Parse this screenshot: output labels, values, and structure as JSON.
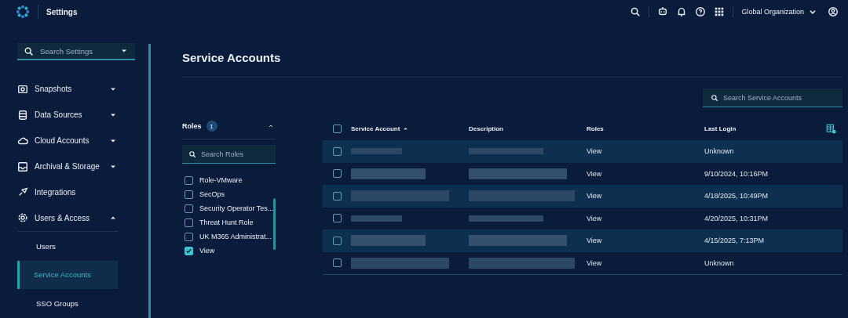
{
  "app": {
    "title": "Settings"
  },
  "header": {
    "organization": "Global Organization"
  },
  "sidebar": {
    "search": {
      "placeholder": "Search Settings"
    },
    "items": [
      {
        "label": "Snapshots",
        "kind": "camera",
        "expanded": false
      },
      {
        "label": "Data Sources",
        "kind": "database",
        "expanded": false
      },
      {
        "label": "Cloud Accounts",
        "kind": "cloud",
        "expanded": false
      },
      {
        "label": "Archival & Storage",
        "kind": "archive",
        "expanded": false
      },
      {
        "label": "Integrations",
        "kind": "plug"
      },
      {
        "label": "Users & Access",
        "kind": "gear",
        "expanded": true,
        "children": [
          {
            "label": "Users",
            "selected": false
          },
          {
            "label": "Service Accounts",
            "selected": true
          },
          {
            "label": "SSO Groups",
            "selected": false
          }
        ]
      }
    ]
  },
  "page": {
    "title": "Service Accounts"
  },
  "roles_filter": {
    "label": "Roles",
    "count": "1",
    "expanded": true,
    "search": {
      "placeholder": "Search Roles"
    },
    "options": [
      {
        "label": "Role-VMware",
        "checked": false
      },
      {
        "label": "SecOps",
        "checked": false
      },
      {
        "label": "Security Operator Tes...",
        "checked": false
      },
      {
        "label": "Threat Hunt Role",
        "checked": false
      },
      {
        "label": "UK M365 Administrat...",
        "checked": false
      },
      {
        "label": "View",
        "checked": true
      }
    ]
  },
  "table": {
    "search": {
      "placeholder": "Search Service Accounts"
    },
    "select_all": {
      "checked": false
    },
    "columns": [
      {
        "label": "Service Account",
        "sorted": true
      },
      {
        "label": "Description",
        "sorted": false
      },
      {
        "label": "Roles",
        "sorted": false
      },
      {
        "label": "Last Login",
        "sorted": false
      }
    ],
    "rows": [
      {
        "selected": false,
        "highlighted": true,
        "redacted": true,
        "roles": "View",
        "last_login": "Unknown"
      },
      {
        "selected": false,
        "highlighted": false,
        "redacted": true,
        "roles": "View",
        "last_login": "9/10/2024, 10:16PM"
      },
      {
        "selected": false,
        "highlighted": true,
        "redacted": true,
        "roles": "View",
        "last_login": "4/18/2025, 10:49PM"
      },
      {
        "selected": false,
        "highlighted": false,
        "redacted": true,
        "roles": "View",
        "last_login": "4/20/2025, 10:31PM"
      },
      {
        "selected": false,
        "highlighted": true,
        "redacted": true,
        "roles": "View",
        "last_login": "4/15/2025, 7:13PM"
      },
      {
        "selected": false,
        "highlighted": false,
        "redacted": true,
        "roles": "View",
        "last_login": "Unknown"
      }
    ]
  }
}
